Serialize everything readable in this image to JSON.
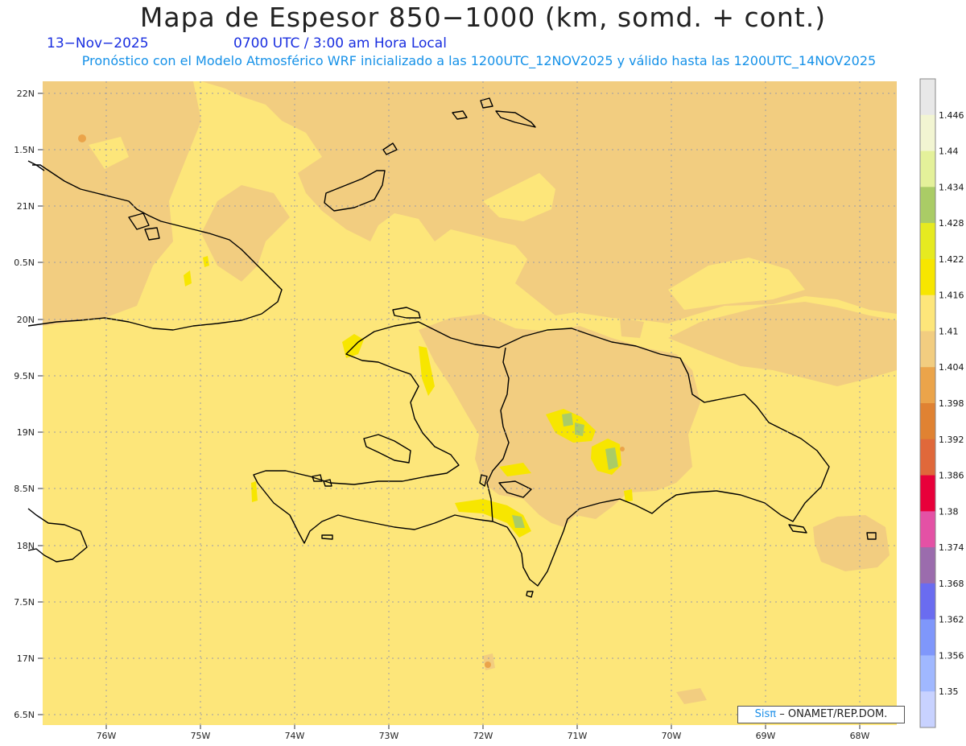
{
  "header": {
    "title": "Mapa de Espesor 850−1000 (km, somd. + cont.)",
    "date": "13−Nov−2025",
    "time": "0700 UTC / 3:00 am Hora Local",
    "forecast_note": "Pronóstico con el Modelo Atmosférico WRF inicializado a las 1200UTC_12NOV2025 y válido hasta las  1200UTC_14NOV2025"
  },
  "map": {
    "lat_labels": [
      "22N",
      "1.5N",
      "21N",
      "0.5N",
      "20N",
      "9.5N",
      "19N",
      "8.5N",
      "18N",
      "7.5N",
      "17N",
      "6.5N"
    ],
    "lon_labels": [
      "76W",
      "75W",
      "74W",
      "73W",
      "72W",
      "71W",
      "70W",
      "69W",
      "68W"
    ],
    "colors": {
      "low_band": "#f2cd80",
      "mid_band": "#fde67a",
      "high_band": "#f7e600",
      "peak_band": "#aacc66",
      "coast": "#000000"
    }
  },
  "colorbar": {
    "labels": [
      "1.446",
      "1.44",
      "1.434",
      "1.428",
      "1.422",
      "1.416",
      "1.41",
      "1.404",
      "1.398",
      "1.392",
      "1.386",
      "1.38",
      "1.374",
      "1.368",
      "1.362",
      "1.356",
      "1.35"
    ],
    "colors": [
      "#e8e8e8",
      "#f2f5d2",
      "#e4f19a",
      "#aacc66",
      "#e6ea20",
      "#f7e600",
      "#fde67a",
      "#f2cd80",
      "#eba44a",
      "#e08232",
      "#e0683a",
      "#e8003a",
      "#e451a5",
      "#9b6cad",
      "#6a6cf0",
      "#7f97fb",
      "#a0b8ff",
      "#c8d2ff"
    ]
  },
  "credit": {
    "brand": "Sisπ",
    "org": "– ONAMET/REP.DOM."
  }
}
